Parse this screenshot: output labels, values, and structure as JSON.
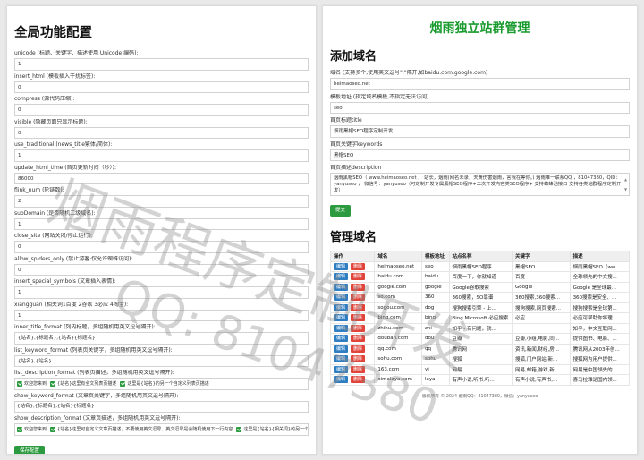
{
  "left": {
    "title": "全局功能配置",
    "fields": [
      {
        "label": "unicode (标题、关键字、描述使用 Unicode 编码):",
        "value": "1"
      },
      {
        "label": "insert_html (模板插入干扰标签):",
        "value": "0"
      },
      {
        "label": "compress (源代码压缩):",
        "value": "0"
      },
      {
        "label": "visible (隐藏页面只显示标题):",
        "value": "0"
      },
      {
        "label": "use_traditional (news_title繁体/简体):",
        "value": "1"
      },
      {
        "label": "update_html_time (首页更新时间（秒）):",
        "value": "86000"
      },
      {
        "label": "flink_num (轮链数):",
        "value": "2"
      },
      {
        "label": "subDomain (是否随机二级域名):",
        "value": "1"
      },
      {
        "label": "close_site (网站关闭/停止运行):",
        "value": "0"
      },
      {
        "label": "allow_spiders_only (禁止游客·仅允许蜘蛛访问):",
        "value": "0"
      },
      {
        "label": "insert_special_symbols (文章插入表情):",
        "value": "1"
      },
      {
        "label": "xiangguan (相关词1百度 2谷歌 3必应 4淘宝):",
        "value": "1"
      },
      {
        "label": "inner_title_format (列内标题，多组随机用英文逗号隔开):",
        "value": "{站名},{标题名},{站名}{标题名}"
      },
      {
        "label": "list_keyword_format (列表页关键字，多组随机用英文逗号隔开):",
        "value": "{站名},{站名}"
      }
    ],
    "check_fields": [
      {
        "label": "list_description_format (列表页描述，多组随机用英文逗号隔开):",
        "items": [
          "欢迎您来到",
          "{站名}这里有全文列表页描述",
          "这里是{站名}的另一个自定义列表页描述"
        ]
      },
      {
        "label": "show_keyword_format (文章页关键字，多组随机用英文逗号隔开):",
        "value": "{站名},{标题名},{站名}{标题名}"
      },
      {
        "label": "show_description_format (文章页描述，多组随机用英文逗号隔开):",
        "items": [
          "欢迎您来到",
          "{站名}这里可自定义文章页描述，不要使用英文逗号、英文逗号是会随机使用下一行内容",
          "这里是{站名}{相关词}的另一个自定义"
        ]
      }
    ],
    "save_label": "保存配置"
  },
  "right": {
    "header": "烟雨独立站群管理",
    "add_title": "添加域名",
    "domain_label": "域名 (支持多个,使用英文逗号\",\"隔开,如baidu.com,google.com)",
    "domain_value": "heimaoseo.net",
    "template_label": "模板地址 (指定域名模板,不指定无法访问)",
    "template_value": "seo",
    "home_title_label": "首页标题title",
    "home_title_value": "烟雨黑帽SEO程序定制开发",
    "home_kw_label": "首页关键字keywords",
    "home_kw_value": "黑帽SEO",
    "home_desc_label": "首页描述description",
    "home_desc_value": "烟雨黑帽SEO（ www.heimaoseo.net ） 站长，烟雨(网名未录，天黄伤害烟雨，言我在等你。) 烟雨唯一联系QQ ，81047380，QID：yanyuseo ， 微信号：yanyuseo（可定制开发专属黑帽SEO程序+二次开发内容类SEO程序+ 支持蜘蛛池接口 支持各类站群程序定制开发）",
    "submit_label": "提交",
    "manage_title": "管理域名",
    "table": {
      "headers": [
        "操作",
        "域名",
        "模板地址",
        "站点名称",
        "关键字",
        "描述"
      ],
      "edit_label": "编辑",
      "delete_label": "删除",
      "rows": [
        [
          "heimaoseo.net",
          "seo",
          "烟雨黑帽SEO程序...",
          "黑帽SEO",
          "烟雨黑帽SEO（ww..."
        ],
        [
          "baidu.com",
          "baidu",
          "百度一下，你就知道",
          "百度",
          "全球领先的中文搜..."
        ],
        [
          "google.com",
          "google",
          "Google谷歌搜索",
          "Google",
          "Google 是全球最..."
        ],
        [
          "so.com",
          "360",
          "360搜索，SO靠谱",
          "360搜索,360搜索...",
          "360搜索是安全、..."
        ],
        [
          "sogou.com",
          "dog",
          "搜狗搜索引擎 - 上...",
          "搜狗搜索,网页搜索...",
          "搜狗搜索是全球第..."
        ],
        [
          "bing.com",
          "bing",
          "Bing Microsoft 必应搜索",
          "必应",
          "必应可帮助你将理..."
        ],
        [
          "zhihu.com",
          "zhi",
          "知乎 - 有问题，就...",
          "",
          "知乎，中文互联网..."
        ],
        [
          "douban.com",
          "dou",
          "豆瓣",
          "豆瓣,小组,电影,同...",
          "提供图书、电影、..."
        ],
        [
          "qq.com",
          "qq",
          "腾讯网",
          "资讯,新闻,财经,房...",
          "腾讯网从2003年创..."
        ],
        [
          "sohu.com",
          "sohu",
          "搜狐",
          "搜狐,门户网站,新...",
          "搜狐网为用户提供..."
        ],
        [
          "163.com",
          "yi",
          "网易",
          "网易,邮箱,游戏,新...",
          "网易是中国领先的..."
        ],
        [
          "ximalaya.com",
          "laya",
          "有声小说,听书,听...",
          "有声小说,有声书,...",
          "喜马拉雅是国内领..."
        ]
      ]
    },
    "footer": "版权所有 © 2024 烟雨QQ：81047380，微信：yanyuseo"
  },
  "watermark": {
    "line1": "烟雨程序定制开发",
    "line2": "QQ: 81047380"
  }
}
